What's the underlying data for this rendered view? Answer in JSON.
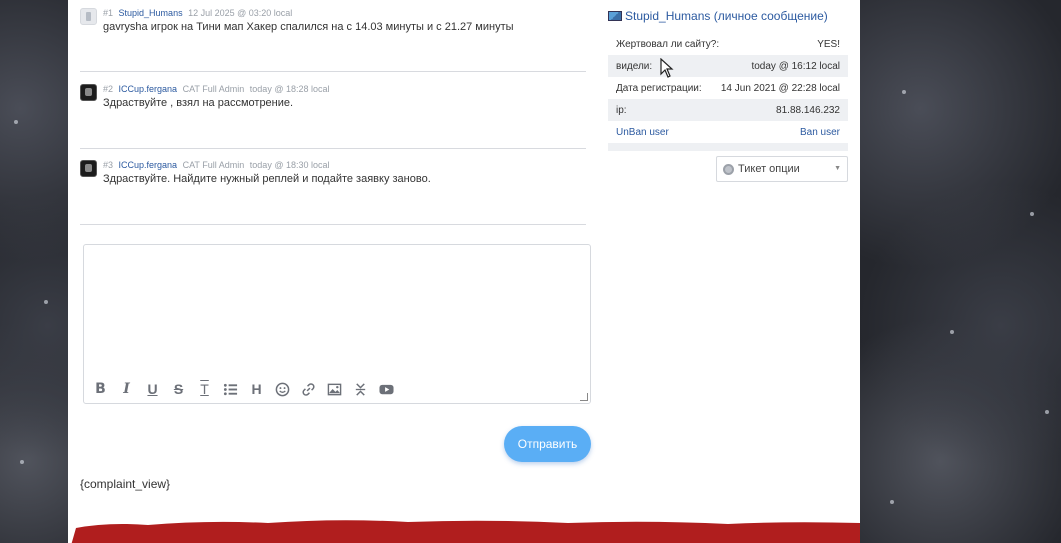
{
  "posts": [
    {
      "num": "#1",
      "user": "Stupid_Humans",
      "role": "",
      "date": "12 Jul 2025 @ 03:20 local",
      "text": "gavrysha игрок на Тини мап Хакер спалился на с 14.03 минуты и с 21.27 минуты"
    },
    {
      "num": "#2",
      "user": "ICCup.fergana",
      "role": "CAT Full Admin",
      "date": "today @ 18:28 local",
      "text": "Здраствуйте , взял на рассмотрение."
    },
    {
      "num": "#3",
      "user": "ICCup.fergana",
      "role": "CAT Full Admin",
      "date": "today @ 18:30 local",
      "text": "Здраствуйте. Найдите нужный реплей и подайте заявку заново."
    }
  ],
  "editor": {
    "toolbar": [
      "bold-icon",
      "italic-icon",
      "underline-icon",
      "strikethrough-icon",
      "text-style-icon",
      "list-icon",
      "heading-icon",
      "emoji-icon",
      "link-icon",
      "image-icon",
      "collapse-icon",
      "youtube-icon"
    ]
  },
  "send_label": "Отправить",
  "complaint_text": "{complaint_view}",
  "panel": {
    "title": "Stupid_Humans (личное сообщение)",
    "rows": [
      {
        "label": "Жертвовал ли сайту?:",
        "value": "YES!"
      },
      {
        "label": "видели:",
        "value": "today @ 16:12 local"
      },
      {
        "label": "Дата регистрации:",
        "value": "14 Jun 2021 @ 22:28 local"
      },
      {
        "label": "ip:",
        "value": "81.88.146.232"
      }
    ],
    "unban": "UnBan user",
    "ban": "Ban user"
  },
  "ticket_options": "Тикет опции",
  "colors": {
    "accent": "#5aaef5",
    "link": "#2c5aa0",
    "banner_red": "#b01e1e"
  }
}
